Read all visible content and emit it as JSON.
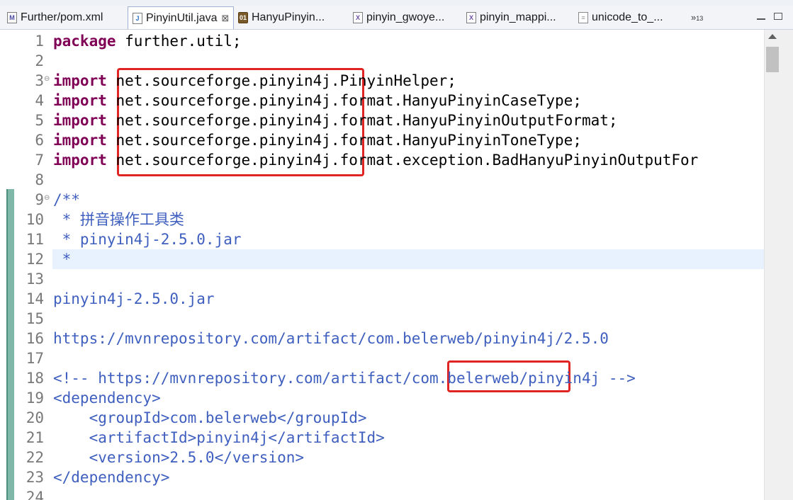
{
  "tabs": [
    {
      "label": "Further/pom.xml",
      "icon": "maven-pom-file-icon",
      "active": false
    },
    {
      "label": "PinyinUtil.java",
      "icon": "java-file-icon",
      "active": true,
      "close": "⊠"
    },
    {
      "label": "HanyuPinyin...",
      "icon": "class-file-icon",
      "active": false
    },
    {
      "label": "pinyin_gwoye...",
      "icon": "xml-file-icon",
      "active": false
    },
    {
      "label": "pinyin_mappi...",
      "icon": "xml-file-icon",
      "active": false
    },
    {
      "label": "unicode_to_...",
      "icon": "text-file-icon",
      "active": false
    }
  ],
  "overflow": {
    "symbol": "»",
    "count": "13"
  },
  "lines": [
    {
      "n": "1",
      "parts": [
        [
          "kw",
          "package"
        ],
        [
          "",
          "further.util;"
        ]
      ]
    },
    {
      "n": "2",
      "parts": []
    },
    {
      "n": "3",
      "fold": "⊖",
      "parts": [
        [
          "kw",
          "import"
        ],
        [
          "",
          "net.sourceforge.pinyin4j.PinyinHelper;"
        ]
      ]
    },
    {
      "n": "4",
      "parts": [
        [
          "kw",
          "import"
        ],
        [
          "",
          "net.sourceforge.pinyin4j.format.HanyuPinyinCaseType;"
        ]
      ]
    },
    {
      "n": "5",
      "parts": [
        [
          "kw",
          "import"
        ],
        [
          "",
          "net.sourceforge.pinyin4j.format.HanyuPinyinOutputFormat;"
        ]
      ]
    },
    {
      "n": "6",
      "parts": [
        [
          "kw",
          "import"
        ],
        [
          "",
          "net.sourceforge.pinyin4j.format.HanyuPinyinToneType;"
        ]
      ]
    },
    {
      "n": "7",
      "parts": [
        [
          "kw",
          "import"
        ],
        [
          "",
          "net.sourceforge.pinyin4j.format.exception.BadHanyuPinyinOutputFor"
        ]
      ]
    },
    {
      "n": "8",
      "parts": []
    },
    {
      "n": "9",
      "fold": "⊖",
      "parts": [
        [
          "cm",
          "/**"
        ]
      ]
    },
    {
      "n": "10",
      "parts": [
        [
          "cm",
          " * 拼音操作工具类"
        ]
      ]
    },
    {
      "n": "11",
      "parts": [
        [
          "cm",
          " * pinyin4j-2.5.0.jar"
        ]
      ]
    },
    {
      "n": "12",
      "current": true,
      "parts": [
        [
          "cm",
          " *"
        ]
      ]
    },
    {
      "n": "13",
      "parts": []
    },
    {
      "n": "14",
      "parts": [
        [
          "cm",
          "pinyin4j-2.5.0.jar"
        ]
      ]
    },
    {
      "n": "15",
      "parts": []
    },
    {
      "n": "16",
      "parts": [
        [
          "cm",
          "https://mvnrepository.com/artifact/com.belerweb/pinyin4j/2.5.0"
        ]
      ]
    },
    {
      "n": "17",
      "parts": []
    },
    {
      "n": "18",
      "parts": [
        [
          "cm",
          "<!-- https://mvnrepository.com/artifact/com.belerweb/pinyin4j -->"
        ]
      ]
    },
    {
      "n": "19",
      "parts": [
        [
          "cm",
          "<dependency>"
        ]
      ]
    },
    {
      "n": "20",
      "parts": [
        [
          "cm",
          "    <groupId>com.belerweb</groupId>"
        ]
      ]
    },
    {
      "n": "21",
      "parts": [
        [
          "cm",
          "    <artifactId>pinyin4j</artifactId>"
        ]
      ]
    },
    {
      "n": "22",
      "parts": [
        [
          "cm",
          "    <version>2.5.0</version>"
        ]
      ]
    },
    {
      "n": "23",
      "parts": [
        [
          "cm",
          "</dependency>"
        ]
      ]
    },
    {
      "n": "24",
      "parts": []
    }
  ],
  "colors": {
    "keyword": "#7f0055",
    "comment": "#3f5fbf",
    "highlight": "#e02424",
    "current_line": "#e8f2fe"
  }
}
